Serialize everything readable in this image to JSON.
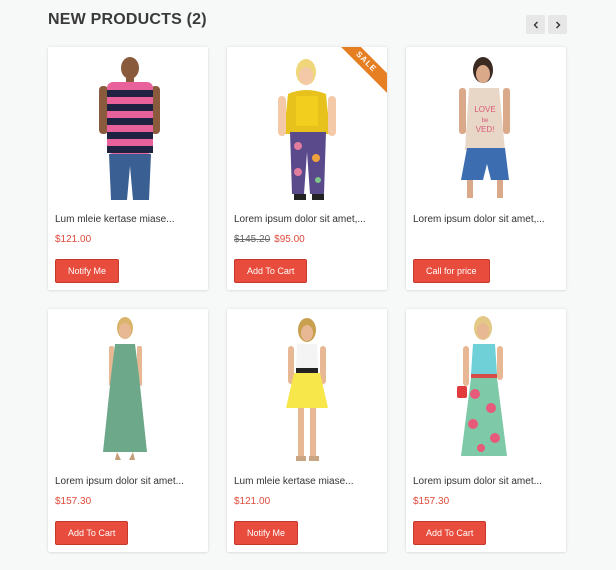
{
  "section": {
    "title": "NEW PRODUCTS (2)"
  },
  "navigation": {
    "prev_icon": "chevron-left-icon",
    "next_icon": "chevron-right-icon"
  },
  "colors": {
    "accent": "#e74c3c",
    "price": "#e04a3b",
    "sale_ribbon": "#e67e22"
  },
  "products": [
    {
      "name": "Lum mleie kertase miase...",
      "price": "$121.00",
      "old_price": "",
      "button": "Notify Me",
      "sale_badge": ""
    },
    {
      "name": "Lorem ipsum dolor sit amet,...",
      "price": "$95.00",
      "old_price": "$145.20",
      "button": "Add To Cart",
      "sale_badge": "SALE"
    },
    {
      "name": "Lorem ipsum dolor sit amet,...",
      "price": "",
      "old_price": "",
      "button": "Call for price",
      "sale_badge": ""
    },
    {
      "name": "Lorem ipsum dolor sit amet...",
      "price": "$157.30",
      "old_price": "",
      "button": "Add To Cart",
      "sale_badge": ""
    },
    {
      "name": "Lum mleie kertase miase...",
      "price": "$121.00",
      "old_price": "",
      "button": "Notify Me",
      "sale_badge": ""
    },
    {
      "name": "Lorem ipsum dolor sit amet...",
      "price": "$157.30",
      "old_price": "",
      "button": "Add To Cart",
      "sale_badge": ""
    }
  ]
}
